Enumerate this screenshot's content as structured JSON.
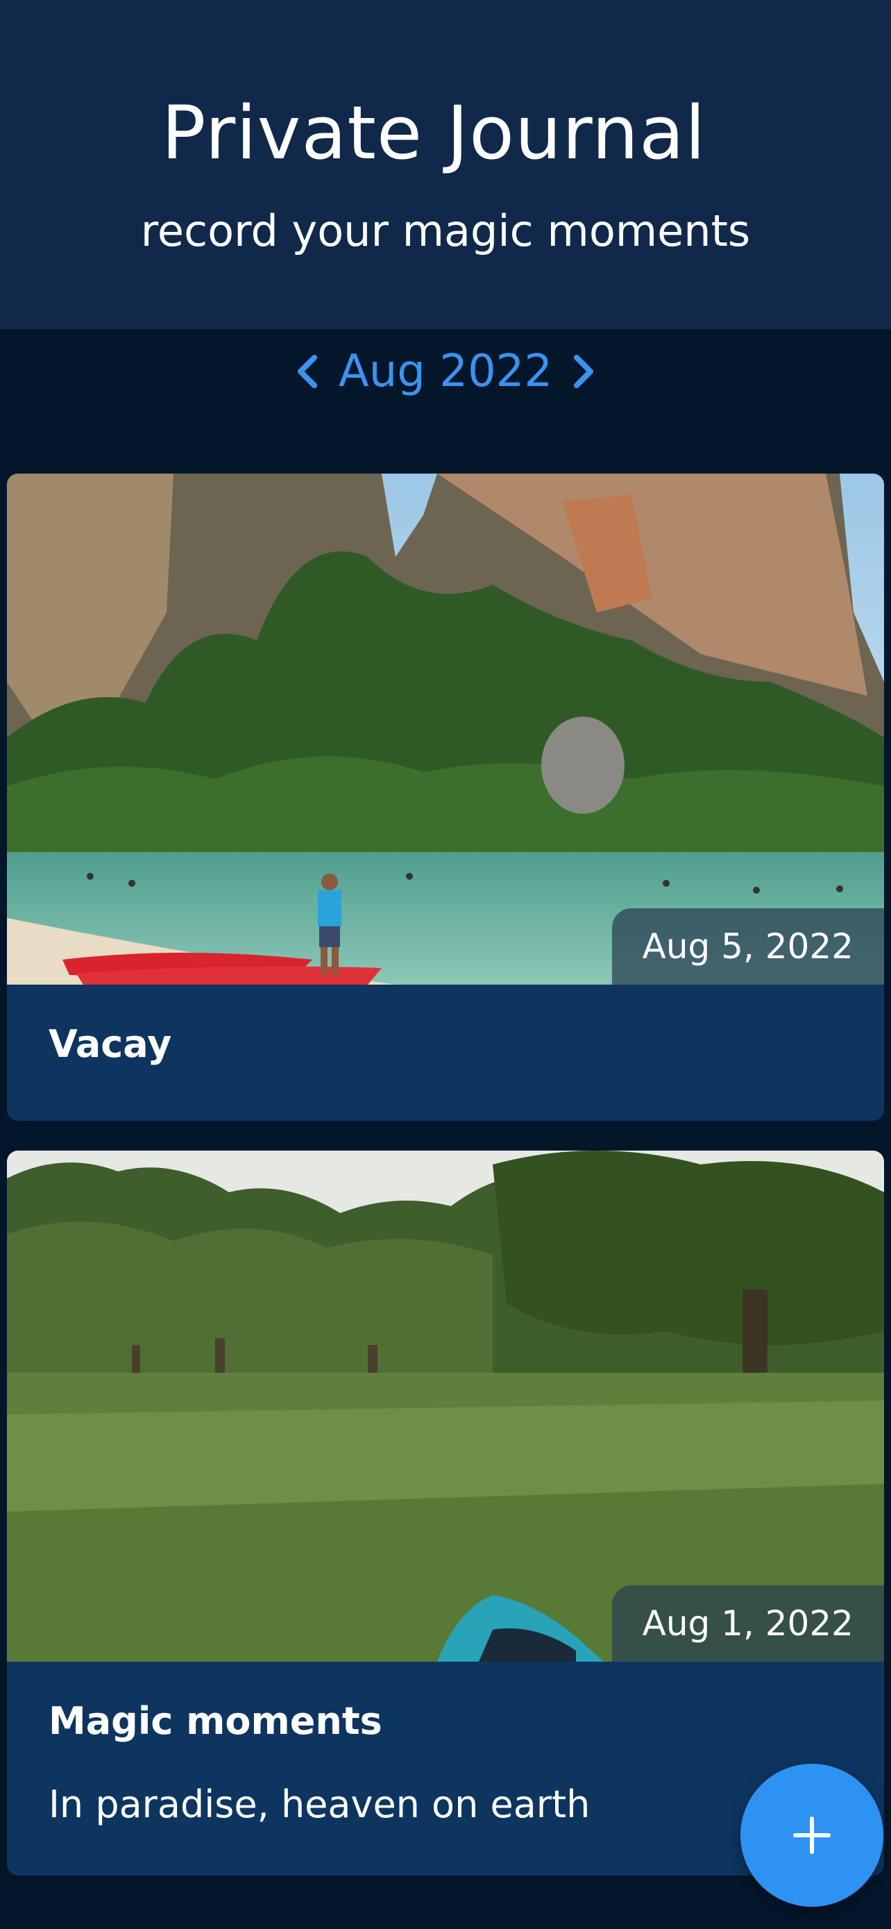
{
  "header": {
    "title": "Private Journal",
    "subtitle": "record your magic moments"
  },
  "month_nav": {
    "label": "Aug 2022",
    "prev_icon": "chevron-left-icon",
    "next_icon": "chevron-right-icon"
  },
  "entries": [
    {
      "date": "Aug 5, 2022",
      "title": "Vacay",
      "body": "",
      "photo": "beach-with-limestone-cliffs-and-red-kayaks"
    },
    {
      "date": "Aug 1, 2022",
      "title": "Magic moments",
      "body": "In paradise, heaven on earth",
      "photo": "grassy-orchard-meadow-with-trees"
    }
  ],
  "fab": {
    "icon": "plus-icon"
  },
  "colors": {
    "header_bg": "#10294a",
    "page_bg": "#03162a",
    "card_bg": "#0d3560",
    "accent": "#2e92f2"
  }
}
